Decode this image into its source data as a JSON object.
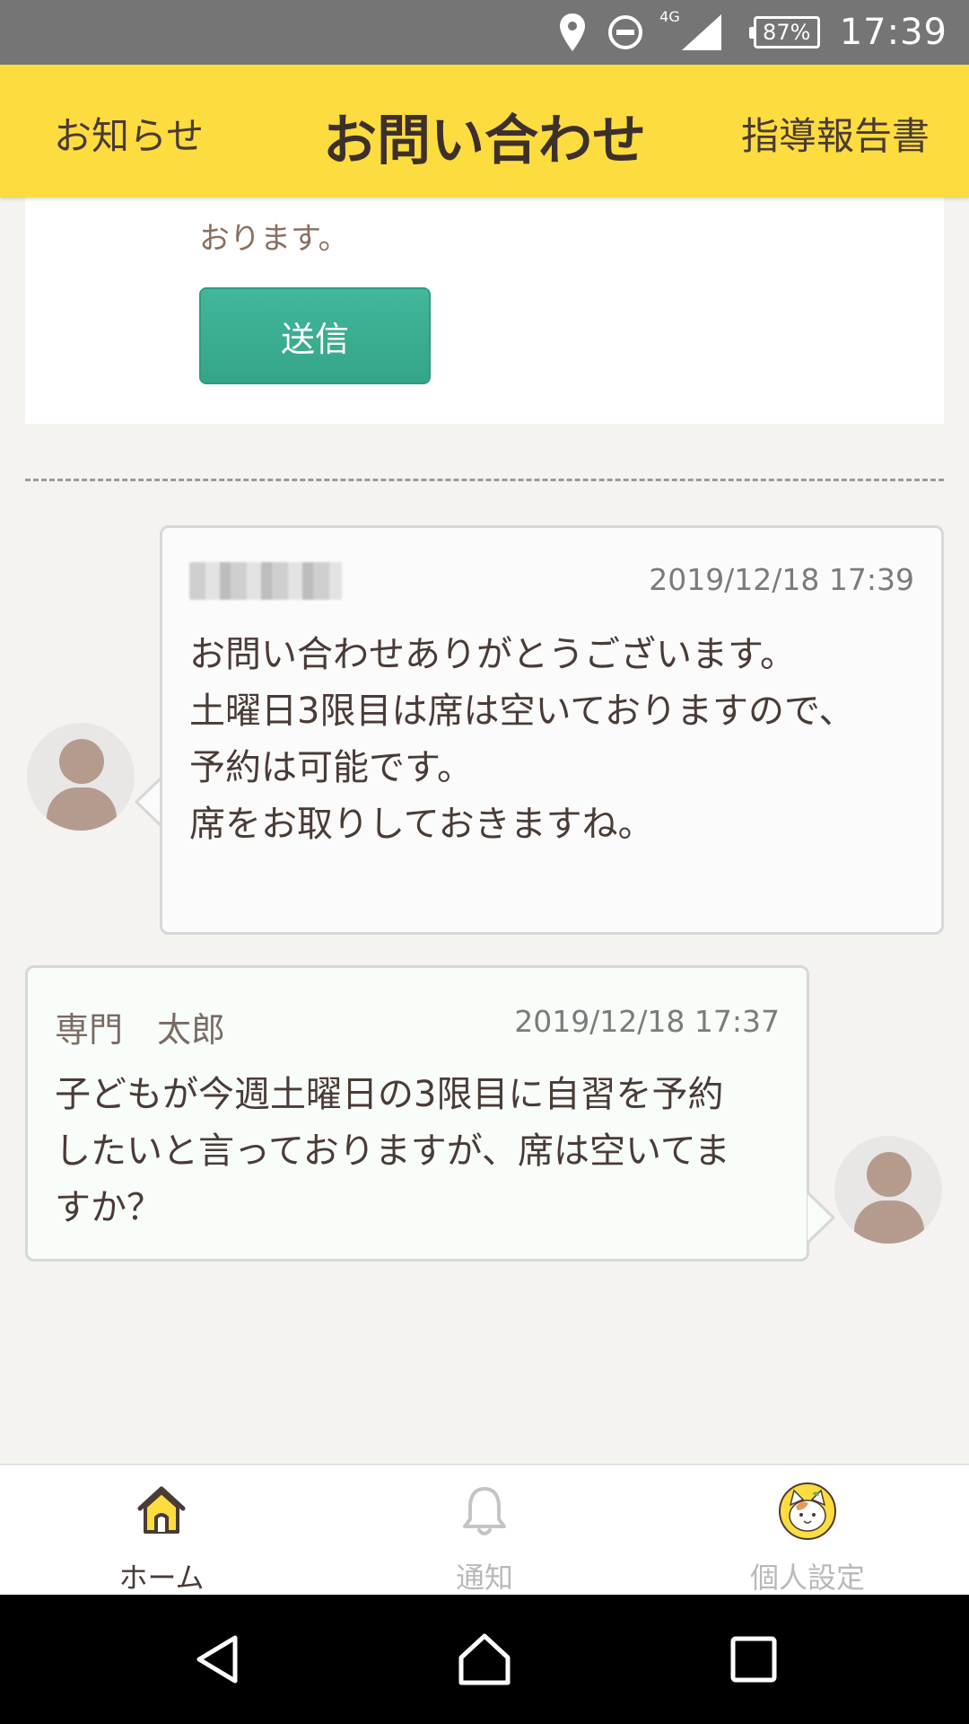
{
  "status_bar": {
    "network_label": "4G",
    "battery": "87%",
    "time": "17:39"
  },
  "header": {
    "left_link": "お知らせ",
    "title": "お問い合わせ",
    "right_link": "指導報告書"
  },
  "form": {
    "note_text": "おります。",
    "send_label": "送信"
  },
  "messages": [
    {
      "sender": "",
      "timestamp": "2019/12/18 17:39",
      "lines": [
        "お問い合わせありがとうございます。",
        "土曜日3限目は席は空いておりますので、",
        "予約は可能です。",
        "席をお取りしておきますね。"
      ]
    },
    {
      "sender": "専門　太郎",
      "timestamp": "2019/12/18 17:37",
      "lines": [
        "子どもが今週土曜日の3限目に自習を予約",
        "したいと言っておりますが、席は空いてま",
        "すか？"
      ]
    }
  ],
  "bottom_nav": {
    "items": [
      {
        "label": "ホーム",
        "icon": "home-icon",
        "active": true
      },
      {
        "label": "通知",
        "icon": "bell-icon",
        "active": false
      },
      {
        "label": "個人設定",
        "icon": "cat-avatar-icon",
        "active": false
      }
    ]
  },
  "colors": {
    "header_bg": "#fcdc3f",
    "send_button": "#3fb394",
    "status_bar": "#757575"
  }
}
